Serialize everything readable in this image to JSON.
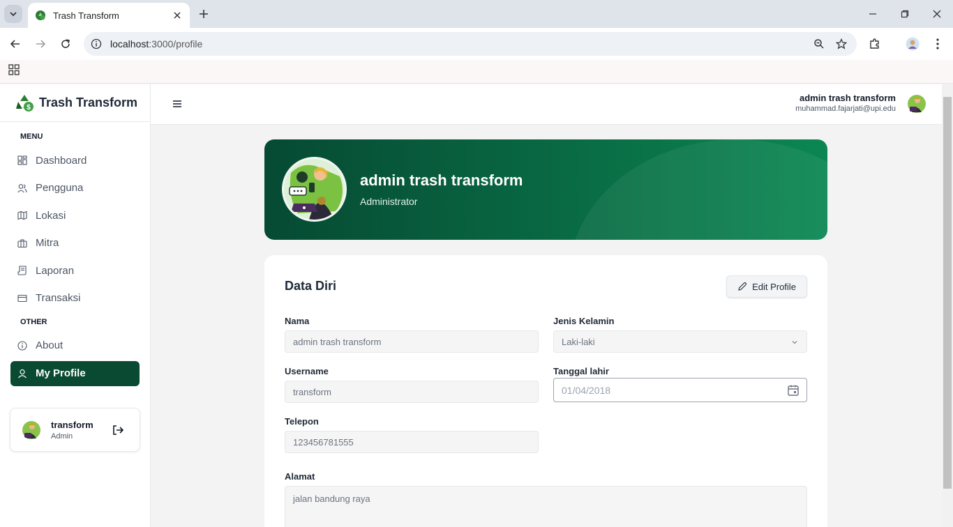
{
  "browser": {
    "tab_title": "Trash Transform",
    "url_host": "localhost",
    "url_rest": ":3000/profile"
  },
  "sidebar": {
    "brand": "Trash Transform",
    "menu_label": "MENU",
    "other_label": "OTHER",
    "menu_items": [
      {
        "label": "Dashboard",
        "icon": "dashboard-icon"
      },
      {
        "label": "Pengguna",
        "icon": "users-icon"
      },
      {
        "label": "Lokasi",
        "icon": "map-icon"
      },
      {
        "label": "Mitra",
        "icon": "briefcase-icon"
      },
      {
        "label": "Laporan",
        "icon": "report-icon"
      },
      {
        "label": "Transaksi",
        "icon": "card-icon"
      }
    ],
    "other_items": [
      {
        "label": "About",
        "icon": "info-icon"
      },
      {
        "label": "My Profile",
        "icon": "user-icon",
        "active": true
      }
    ],
    "user_card": {
      "name": "transform",
      "role": "Admin"
    }
  },
  "header": {
    "name": "admin trash transform",
    "email": "muhammad.fajarjati@upi.edu"
  },
  "banner": {
    "name": "admin trash transform",
    "role": "Administrator"
  },
  "profile": {
    "title": "Data Diri",
    "edit_label": "Edit Profile",
    "fields": {
      "nama_label": "Nama",
      "nama_value": "admin trash transform",
      "username_label": "Username",
      "username_value": "transform",
      "telepon_label": "Telepon",
      "telepon_value": "123456781555",
      "gender_label": "Jenis Kelamin",
      "gender_value": "Laki-laki",
      "dob_label": "Tanggal lahir",
      "dob_value": "01/04/2018",
      "alamat_label": "Alamat",
      "alamat_value": "jalan bandung raya"
    }
  },
  "colors": {
    "accent": "#0a4a33",
    "banner_start": "#064a33",
    "banner_end": "#0b8752"
  }
}
